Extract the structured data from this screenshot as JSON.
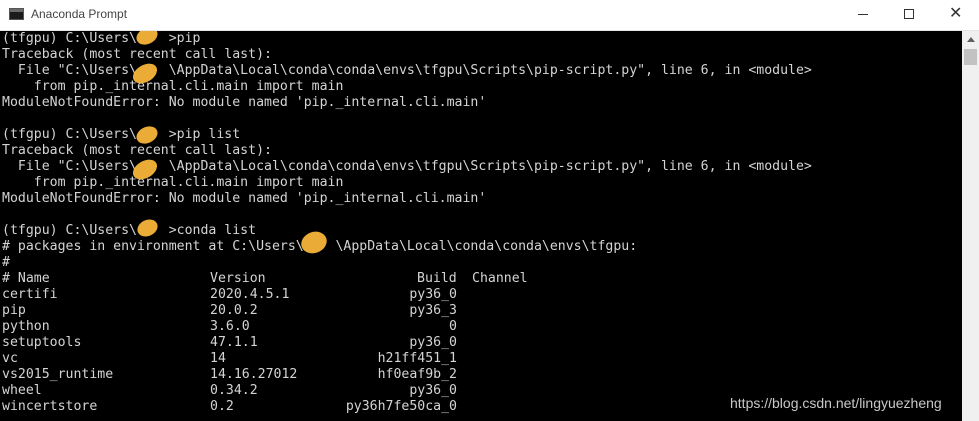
{
  "window": {
    "title": "Anaconda Prompt",
    "icon": "console-window-icon",
    "controls": [
      "minimize-icon",
      "maximize-icon",
      "close-icon"
    ],
    "close_glyph": "✕"
  },
  "console": {
    "lines": [
      "(tfgpu) C:\\Users\\    >pip",
      "Traceback (most recent call last):",
      "  File \"C:\\Users\\    \\AppData\\Local\\conda\\conda\\envs\\tfgpu\\Scripts\\pip-script.py\", line 6, in <module>",
      "    from pip._internal.cli.main import main",
      "ModuleNotFoundError: No module named 'pip._internal.cli.main'",
      "",
      "(tfgpu) C:\\Users\\    >pip list",
      "Traceback (most recent call last):",
      "  File \"C:\\Users\\    \\AppData\\Local\\conda\\conda\\envs\\tfgpu\\Scripts\\pip-script.py\", line 6, in <module>",
      "    from pip._internal.cli.main import main",
      "ModuleNotFoundError: No module named 'pip._internal.cli.main'",
      "",
      "(tfgpu) C:\\Users\\    >conda list",
      "# packages in environment at C:\\Users\\    \\AppData\\Local\\conda\\conda\\envs\\tfgpu:",
      "#"
    ],
    "table_header": {
      "name": "# Name",
      "version": "Version",
      "build": "Build",
      "channel": "Channel"
    },
    "packages": [
      {
        "name": "certifi",
        "version": "2020.4.5.1",
        "build": "py36_0"
      },
      {
        "name": "pip",
        "version": "20.0.2",
        "build": "py36_3"
      },
      {
        "name": "python",
        "version": "3.6.0",
        "build": "0"
      },
      {
        "name": "setuptools",
        "version": "47.1.1",
        "build": "py36_0"
      },
      {
        "name": "vc",
        "version": "14",
        "build": "h21ff451_1"
      },
      {
        "name": "vs2015_runtime",
        "version": "14.16.27012",
        "build": "hf0eaf9b_2"
      },
      {
        "name": "wheel",
        "version": "0.34.2",
        "build": "py36_0"
      },
      {
        "name": "wincertstore",
        "version": "0.2",
        "build": "py36h7fe50ca_0"
      }
    ]
  },
  "watermark": "https://blog.csdn.net/lingyuezheng",
  "colors": {
    "console_bg": "#000000",
    "console_text": "#d4d4d4",
    "redaction": "#f7b43a",
    "titlebar_bg": "#ffffff"
  }
}
